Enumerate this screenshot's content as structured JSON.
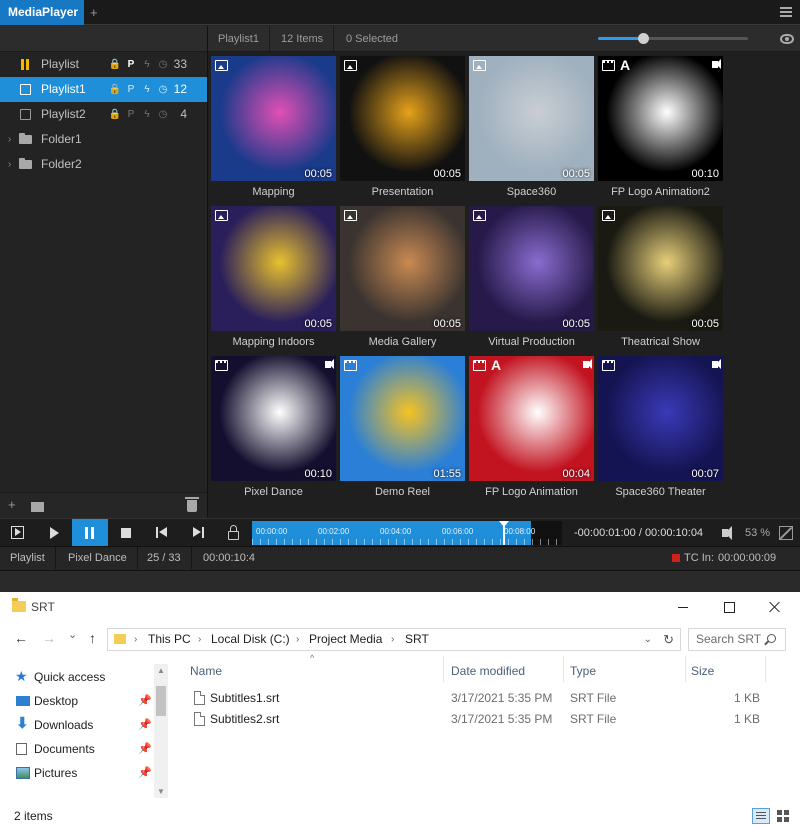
{
  "media_player": {
    "tab_title": "MediaPlayer",
    "add_tab": "+",
    "playlists": [
      {
        "label": "Playlist",
        "lock": "🔒",
        "p": "P",
        "bolt": "ϟ",
        "clock": "◷",
        "count": "33"
      },
      {
        "label": "Playlist1",
        "lock": "🔒",
        "p": "P",
        "bolt": "ϟ",
        "clock": "◷",
        "count": "12"
      },
      {
        "label": "Playlist2",
        "lock": "🔒",
        "p": "P",
        "bolt": "ϟ",
        "clock": "◷",
        "count": "4"
      }
    ],
    "folders": [
      {
        "label": "Folder1",
        "chev": "›"
      },
      {
        "label": "Folder2",
        "chev": "›"
      }
    ],
    "footer_add": "+",
    "info": {
      "playlist": "Playlist1",
      "items": "12 Items",
      "selected": "0 Selected"
    },
    "thumb_size_level": 0.3,
    "tiles": [
      {
        "label": "Mapping",
        "duration": "00:05",
        "type": "image",
        "alpha": "",
        "sound": false,
        "bg": "#1a3a8a",
        "accent": "#e14fb5"
      },
      {
        "label": "Presentation",
        "duration": "00:05",
        "type": "image",
        "alpha": "",
        "sound": false,
        "bg": "#111111",
        "accent": "#e6a21a"
      },
      {
        "label": "Space360",
        "duration": "00:05",
        "type": "image",
        "alpha": "",
        "sound": false,
        "bg": "#9fb0bf",
        "accent": "#c9ced3"
      },
      {
        "label": "FP Logo Animation2",
        "duration": "00:10",
        "type": "video",
        "alpha": "A",
        "sound": true,
        "bg": "#000000",
        "accent": "#ffffff"
      },
      {
        "label": "Mapping Indoors",
        "duration": "00:05",
        "type": "image",
        "alpha": "",
        "sound": false,
        "bg": "#2a1f5a",
        "accent": "#e8c12f"
      },
      {
        "label": "Media Gallery",
        "duration": "00:05",
        "type": "image",
        "alpha": "",
        "sound": false,
        "bg": "#3a3330",
        "accent": "#c98a52"
      },
      {
        "label": "Virtual Production",
        "duration": "00:05",
        "type": "image",
        "alpha": "",
        "sound": false,
        "bg": "#271a4a",
        "accent": "#8a6cd0"
      },
      {
        "label": "Theatrical Show",
        "duration": "00:05",
        "type": "image",
        "alpha": "",
        "sound": false,
        "bg": "#1a1a12",
        "accent": "#e7cf7a"
      },
      {
        "label": "Pixel Dance",
        "duration": "00:10",
        "type": "video",
        "alpha": "",
        "sound": true,
        "bg": "#140f2e",
        "accent": "#ffffff"
      },
      {
        "label": "Demo Reel",
        "duration": "01:55",
        "type": "video",
        "alpha": "",
        "sound": false,
        "bg": "#2b7fd6",
        "accent": "#f6c323"
      },
      {
        "label": "FP Logo Animation",
        "duration": "00:04",
        "type": "video",
        "alpha": "A",
        "sound": true,
        "bg": "#c21320",
        "accent": "#ffffff"
      },
      {
        "label": "Space360 Theater",
        "duration": "00:07",
        "type": "video",
        "alpha": "",
        "sound": true,
        "bg": "#151453",
        "accent": "#3a3ab8"
      }
    ],
    "transport": {
      "timeline_labels": [
        "00:00:00",
        "00:02:00",
        "00:04:00",
        "00:06:00",
        "00:08:00"
      ],
      "progress": 0.9,
      "timecode": "-00:00:01:00 / 00:00:10:04",
      "volume": "53 %"
    },
    "status": {
      "playlist": "Playlist",
      "clip": "Pixel Dance",
      "position": "25 / 33",
      "time": "00:00:10:4",
      "tc_in": "TC In:",
      "tc_value": "00:00:00:09"
    }
  },
  "explorer": {
    "title": "SRT",
    "back": "←",
    "forward": "→",
    "recent": "⌄",
    "up": "↑",
    "breadcrumb": [
      "This PC",
      "Local Disk (C:)",
      "Project Media",
      "SRT"
    ],
    "breadcrumb_sep": "›",
    "address_dropdown": "⌄",
    "refresh": "↻",
    "search_placeholder": "Search SRT",
    "nav": [
      {
        "label": "Quick access",
        "pinned": false
      },
      {
        "label": "Desktop",
        "pinned": true
      },
      {
        "label": "Downloads",
        "pinned": true
      },
      {
        "label": "Documents",
        "pinned": true
      },
      {
        "label": "Pictures",
        "pinned": true
      }
    ],
    "pin_glyph": "📌",
    "scroll_up": "▲",
    "scroll_down": "▼",
    "sort_glyph": "^",
    "columns": {
      "name": "Name",
      "date": "Date modified",
      "type": "Type",
      "size": "Size"
    },
    "files": [
      {
        "name": "Subtitles1.srt",
        "date": "3/17/2021 5:35 PM",
        "type": "SRT File",
        "size": "1 KB"
      },
      {
        "name": "Subtitles2.srt",
        "date": "3/17/2021 5:35 PM",
        "type": "SRT File",
        "size": "1 KB"
      }
    ],
    "status": "2 items"
  }
}
